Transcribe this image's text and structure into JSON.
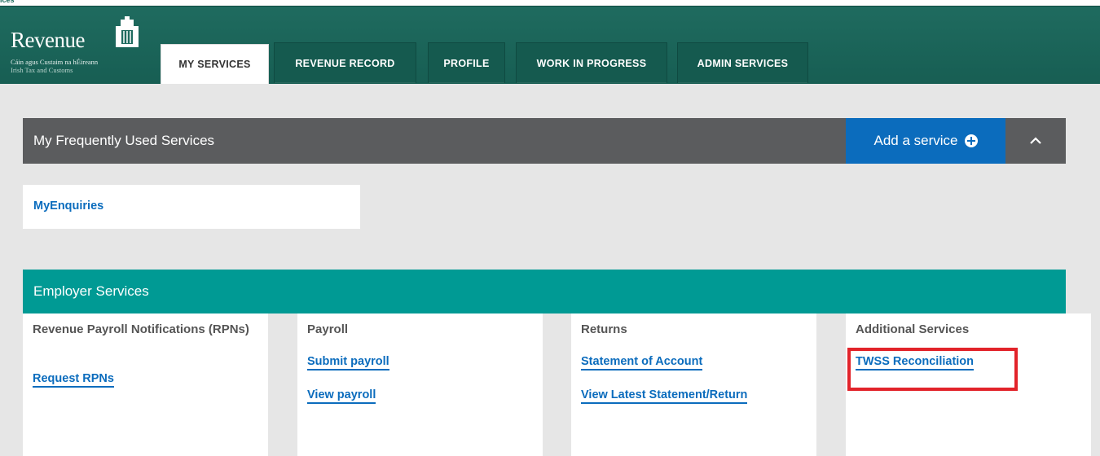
{
  "top_strip": {
    "text": "ices"
  },
  "logo": {
    "name": "Revenue",
    "sub_irish": "Cáin agus Custaim na hÉireann",
    "sub_english": "Irish Tax and Customs"
  },
  "tabs": [
    {
      "label": "MY SERVICES",
      "active": true
    },
    {
      "label": "REVENUE RECORD",
      "active": false
    },
    {
      "label": "PROFILE",
      "active": false
    },
    {
      "label": "WORK IN PROGRESS",
      "active": false
    },
    {
      "label": "ADMIN SERVICES",
      "active": false
    }
  ],
  "frequently_used": {
    "title": "My Frequently Used Services",
    "add_label": "Add a service",
    "items": [
      {
        "label": "MyEnquiries"
      }
    ]
  },
  "employer_services": {
    "title": "Employer Services",
    "columns": [
      {
        "heading": "Revenue Payroll Notifications (RPNs)",
        "links": [
          "Request RPNs"
        ]
      },
      {
        "heading": "Payroll",
        "links": [
          "Submit payroll",
          "View payroll"
        ]
      },
      {
        "heading": "Returns",
        "links": [
          "Statement of Account",
          "View Latest Statement/Return"
        ]
      },
      {
        "heading": "Additional Services",
        "links": [
          "TWSS Reconciliation"
        ]
      }
    ]
  },
  "colors": {
    "header": "#1f6b5f",
    "teal_bar": "#009a94",
    "grey_bar": "#5b5c5e",
    "link_blue": "#0b6cbd",
    "highlight_red": "#e2232a"
  },
  "icons": {
    "add": "plus-circle-icon",
    "collapse": "chevron-up-icon",
    "logo": "harp-icon"
  }
}
